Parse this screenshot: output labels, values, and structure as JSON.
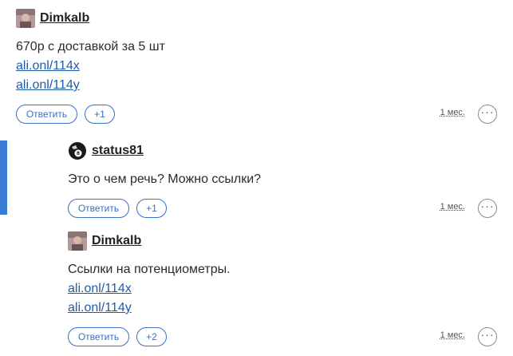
{
  "comments": [
    {
      "author": "Dimkalb",
      "avatar_icon": "user-avatar-photo",
      "text": "670р с доставкой за 5 шт",
      "links": [
        "ali.onl/114x",
        "ali.onl/114y"
      ],
      "reply_label": "Ответить",
      "votes": "+1",
      "time": "1 мес.",
      "more_label": "···"
    },
    {
      "author": "status81",
      "avatar_icon": "billiard-8-ball-avatar",
      "text": "Это о чем речь? Можно ссылки?",
      "links": [],
      "reply_label": "Ответить",
      "votes": "+1",
      "time": "1 мес.",
      "more_label": "···"
    },
    {
      "author": "Dimkalb",
      "avatar_icon": "user-avatar-photo",
      "text": "Ссылки на потенциометры.",
      "links": [
        "ali.onl/114x",
        "ali.onl/114y"
      ],
      "reply_label": "Ответить",
      "votes": "+2",
      "time": "1 мес.",
      "more_label": "···"
    }
  ],
  "colors": {
    "accent": "#3a7bd5",
    "link": "#1f5ca8",
    "button": "#3a6fc1"
  }
}
